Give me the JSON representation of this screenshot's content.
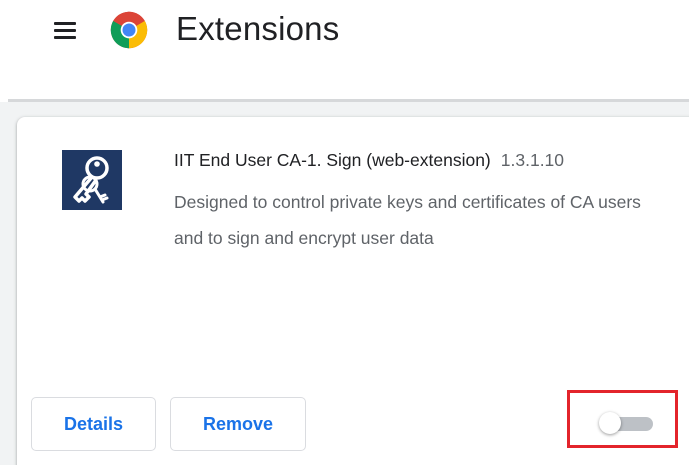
{
  "header": {
    "menu_icon": "hamburger-menu-icon",
    "logo_icon": "chrome-logo-icon",
    "title": "Extensions"
  },
  "extension": {
    "icon": "keys-icon",
    "name": "IIT End User CA-1. Sign (web-extension)",
    "version": "1.3.1.10",
    "description": "Designed to control private keys and certificates of CA users and to sign and encrypt user data",
    "details_label": "Details",
    "remove_label": "Remove",
    "enabled": false
  },
  "colors": {
    "accent": "#1a73e8",
    "highlight": "#e3242b",
    "icon_bg": "#1f3864",
    "toggle_off": "#bdc1c6"
  }
}
